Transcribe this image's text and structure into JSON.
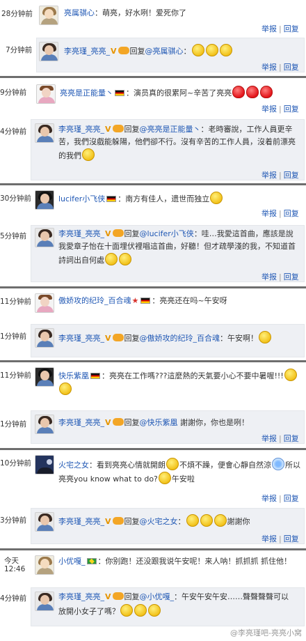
{
  "actions": {
    "report": "举报",
    "reply": "回复",
    "separator": "|"
  },
  "reply_prefix": "回复",
  "watermark": "@李亮瑾吧-亮亮小窝",
  "threads": [
    {
      "comment": {
        "time": "28分钟前",
        "user": "亮属骐心",
        "text": "：萌亮，好水咧！爱死你了"
      },
      "reply": {
        "time": "7分钟前",
        "user": "李亮瑾_亮亮_",
        "vip": "V",
        "at": "@亮属骐心",
        "text": "："
      }
    },
    {
      "comment": {
        "time": "9分钟前",
        "user": "亮亮是正能量丶",
        "text": "：演员真的很累阿~辛苦了亮亮"
      },
      "reply": {
        "time": "4分钟前",
        "user": "李亮瑾_亮亮_",
        "vip": "V",
        "at": "@亮亮是正能量丶",
        "text1": "：老時審說，工作人員更辛",
        "text2": "苦，我們沒戲能躲陽，他們卻不行。沒有辛苦的工作人員，沒着前漂亮",
        "text3": "的我們"
      }
    },
    {
      "comment": {
        "time": "30分钟前",
        "user": "lucifer小飞侠",
        "text": "：南方有佳人，遗世而独立"
      },
      "reply": {
        "time": "5分钟前",
        "user": "李亮瑾_亮亮_",
        "vip": "V",
        "at": "@lucifer小飞侠",
        "text1": "：哇…我愛這首曲，應該是說",
        "text2": "我愛章子怡在十面埋伏裡唱這首曲，好聽！但才疏學淺的我，不知道首",
        "text3": "詩詞出自何處"
      }
    },
    {
      "comment": {
        "time": "11分钟前",
        "user": "傲娇攻的纪玲_百合魂",
        "text": "：亮亮还在吗~午安呀"
      },
      "reply": {
        "time": "1分钟前",
        "user": "李亮瑾_亮亮_",
        "vip": "V",
        "at": "@傲娇攻的纪玲_百合魂",
        "text": "：午安啊！"
      }
    },
    {
      "comment": {
        "time": "11分钟前",
        "user": "快乐紫凰",
        "text1": "：亮亮在工作嗎???這麼熱的天氣要小心不要中暑喔!!!"
      },
      "reply": {
        "time": "1分钟前",
        "user": "李亮瑾_亮亮_",
        "vip": "V",
        "at": "@快乐紫凰",
        "text": " 謝謝你，你也是咧！"
      }
    },
    {
      "comment": {
        "time": "10分钟前",
        "user": "火宅之女",
        "text1": "：看到亮亮心情就開朗",
        "text1b": "不煩不躁，便會心靜自然涼",
        "text1c": "所以",
        "text2": "亮亮you know what to do?",
        "text2b": "午安啦"
      },
      "reply": {
        "time": "3分钟前",
        "user": "李亮瑾_亮亮_",
        "vip": "V",
        "at": "@火宅之女",
        "text": "：",
        "text_after": "謝謝你"
      }
    },
    {
      "comment": {
        "time": "今天",
        "time2": "12:46",
        "user": "小优嘎_",
        "text": "：你别跑！还没跟我说午安呢！来人呐！抓抓抓 抓住他！"
      },
      "reply": {
        "time": "4分钟前",
        "user": "李亮瑾_亮亮_",
        "vip": "V",
        "at": "@小优嘎_",
        "text1": "：午安午安午安……聲聲聲聲可以",
        "text2": "放開小女子了嗎？"
      }
    }
  ]
}
